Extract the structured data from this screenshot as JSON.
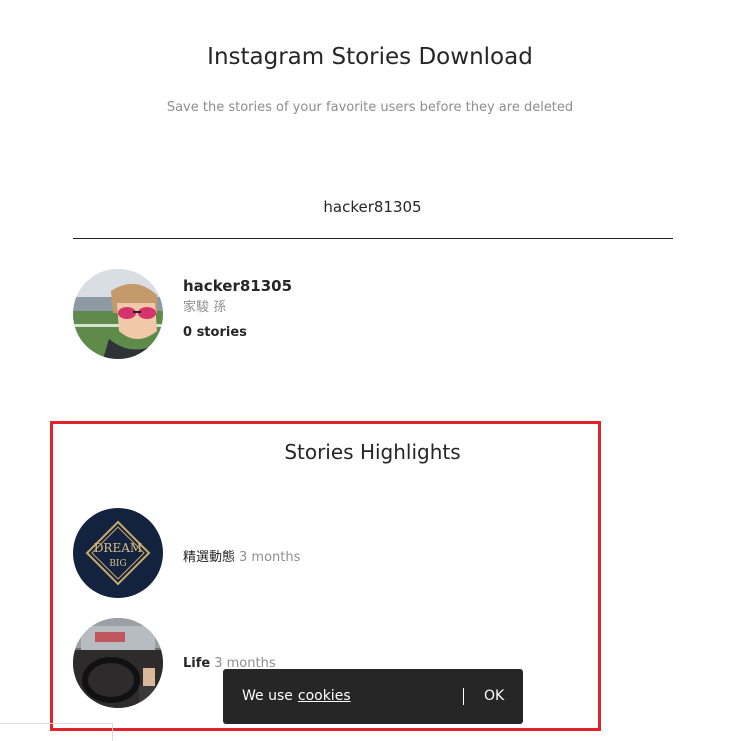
{
  "header": {
    "title": "Instagram Stories Download",
    "subtitle": "Save the stories of your favorite users before they are deleted"
  },
  "search": {
    "value": "hacker81305"
  },
  "profile": {
    "username": "hacker81305",
    "full_name": "家駿 孫",
    "stories_count": "0 stories"
  },
  "highlights": {
    "title": "Stories Highlights",
    "items": [
      {
        "name": "精選動態",
        "age": "3 months",
        "cover_text_top": "DREAM",
        "cover_text_bottom": "BIG"
      },
      {
        "name": "Life",
        "age": "3 months"
      }
    ]
  },
  "cookie_bar": {
    "text": "We use",
    "link": "cookies",
    "ok": "OK"
  },
  "colors": {
    "accent_border": "#e2232a",
    "cookie_bg": "#262626",
    "muted": "#8e8e8e"
  }
}
